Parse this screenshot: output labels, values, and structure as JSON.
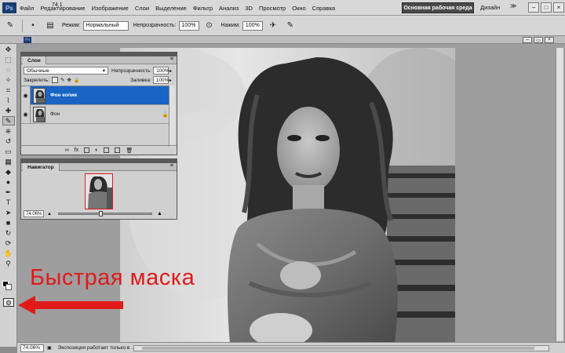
{
  "menubar": {
    "app_logo": "Ps",
    "items": [
      "Файл",
      "Редактирование",
      "Изображение",
      "Слои",
      "Выделение",
      "Фильтр",
      "Анализ",
      "3D",
      "Просмотр",
      "Окно",
      "Справка"
    ],
    "zoom_mini": "74,1",
    "workspace_button": "Основная рабочая среда",
    "design_label": "Дизайн",
    "chevron": "≫"
  },
  "optionsbar": {
    "mode_label": "Режим:",
    "mode_value": "Нормальный",
    "opacity_label": "Непрозрачность:",
    "opacity_value": "100%",
    "flow_label": "Нажим:",
    "flow_value": "100%"
  },
  "document_tab": {
    "icon": "Ps"
  },
  "layers_panel": {
    "tab": "Слои",
    "blend_value": "Обычные",
    "opacity_label": "Непрозрачность:",
    "opacity_value": "100%",
    "lock_label": "Закрепить:",
    "fill_label": "Заливка:",
    "fill_value": "100%",
    "layers": [
      {
        "name": "Фон копия",
        "selected": true
      },
      {
        "name": "Фон",
        "selected": false,
        "locked": true
      }
    ]
  },
  "navigator_panel": {
    "tab": "Навигатор",
    "zoom_value": "74.06%",
    "slider_value": 0.45
  },
  "annotation": {
    "text": "Быстрая маска",
    "color": "#e11a1a"
  },
  "statusbar": {
    "zoom": "74.06%",
    "text": "Экспозиция работает только в ..."
  },
  "colors": {
    "selection": "#1964c4",
    "accent_red": "#e11a1a"
  },
  "icons": [
    "brush-icon",
    "eye-icon",
    "lock-icon",
    "navigator-thumbnail",
    "quick-mask-icon"
  ]
}
